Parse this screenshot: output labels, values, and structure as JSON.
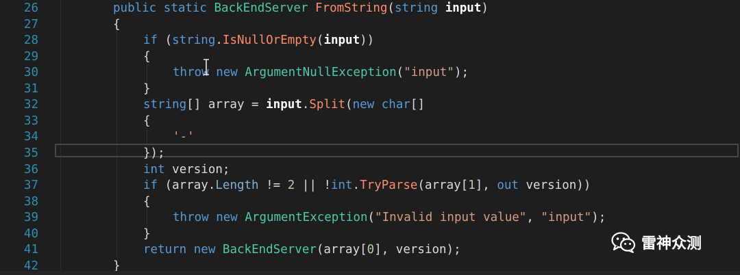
{
  "editor": {
    "lines": [
      {
        "num": "26",
        "indent": 165,
        "tokens": [
          {
            "t": "public static ",
            "c": "kw"
          },
          {
            "t": "BackEndServer ",
            "c": "ty"
          },
          {
            "t": "FromString",
            "c": "method"
          },
          {
            "t": "(",
            "c": "pr"
          },
          {
            "t": "string ",
            "c": "kw"
          },
          {
            "t": "input",
            "c": "bold"
          },
          {
            "t": ")",
            "c": "pr"
          }
        ]
      },
      {
        "num": "27",
        "indent": 165,
        "tokens": [
          {
            "t": "{",
            "c": "pr"
          }
        ]
      },
      {
        "num": "28",
        "indent": 209,
        "tokens": [
          {
            "t": "if ",
            "c": "kw"
          },
          {
            "t": "(",
            "c": "pr"
          },
          {
            "t": "string",
            "c": "kw"
          },
          {
            "t": ".",
            "c": "pr"
          },
          {
            "t": "IsNullOrEmpty",
            "c": "method"
          },
          {
            "t": "(",
            "c": "pr"
          },
          {
            "t": "input",
            "c": "bold"
          },
          {
            "t": "))",
            "c": "pr"
          }
        ]
      },
      {
        "num": "29",
        "indent": 209,
        "tokens": [
          {
            "t": "{",
            "c": "pr"
          }
        ]
      },
      {
        "num": "30",
        "indent": 252,
        "tokens": [
          {
            "t": "throw ",
            "c": "kw"
          },
          {
            "t": "new ",
            "c": "kw"
          },
          {
            "t": "ArgumentNullException",
            "c": "ty"
          },
          {
            "t": "(",
            "c": "pr"
          },
          {
            "t": "\"input\"",
            "c": "str"
          },
          {
            "t": ");",
            "c": "pr"
          }
        ]
      },
      {
        "num": "31",
        "indent": 209,
        "tokens": [
          {
            "t": "}",
            "c": "pr"
          }
        ]
      },
      {
        "num": "32",
        "indent": 209,
        "tokens": [
          {
            "t": "string",
            "c": "kw"
          },
          {
            "t": "[] array = ",
            "c": "id"
          },
          {
            "t": "input",
            "c": "bold"
          },
          {
            "t": ".",
            "c": "pr"
          },
          {
            "t": "Split",
            "c": "method"
          },
          {
            "t": "(",
            "c": "pr"
          },
          {
            "t": "new ",
            "c": "kw"
          },
          {
            "t": "char",
            "c": "kw"
          },
          {
            "t": "[]",
            "c": "pr"
          }
        ]
      },
      {
        "num": "33",
        "indent": 209,
        "tokens": [
          {
            "t": "{",
            "c": "pr"
          }
        ]
      },
      {
        "num": "34",
        "indent": 252,
        "tokens": [
          {
            "t": "'-'",
            "c": "str"
          }
        ]
      },
      {
        "num": "35",
        "indent": 209,
        "tokens": [
          {
            "t": "});",
            "c": "pr"
          }
        ]
      },
      {
        "num": "36",
        "indent": 209,
        "tokens": [
          {
            "t": "int ",
            "c": "kw"
          },
          {
            "t": "version;",
            "c": "id"
          }
        ]
      },
      {
        "num": "37",
        "indent": 209,
        "tokens": [
          {
            "t": "if ",
            "c": "kw"
          },
          {
            "t": "(array.",
            "c": "id"
          },
          {
            "t": "Length",
            "c": "prop"
          },
          {
            "t": " != ",
            "c": "pr"
          },
          {
            "t": "2",
            "c": "nm"
          },
          {
            "t": " || !",
            "c": "pr"
          },
          {
            "t": "int",
            "c": "kw"
          },
          {
            "t": ".",
            "c": "pr"
          },
          {
            "t": "TryParse",
            "c": "method"
          },
          {
            "t": "(array[",
            "c": "id"
          },
          {
            "t": "1",
            "c": "nm"
          },
          {
            "t": "], ",
            "c": "pr"
          },
          {
            "t": "out ",
            "c": "kw"
          },
          {
            "t": "version))",
            "c": "id"
          }
        ]
      },
      {
        "num": "38",
        "indent": 209,
        "tokens": [
          {
            "t": "{",
            "c": "pr"
          }
        ]
      },
      {
        "num": "39",
        "indent": 252,
        "tokens": [
          {
            "t": "throw ",
            "c": "kw"
          },
          {
            "t": "new ",
            "c": "kw"
          },
          {
            "t": "ArgumentException",
            "c": "ty"
          },
          {
            "t": "(",
            "c": "pr"
          },
          {
            "t": "\"Invalid input value\"",
            "c": "str"
          },
          {
            "t": ", ",
            "c": "pr"
          },
          {
            "t": "\"input\"",
            "c": "str"
          },
          {
            "t": ");",
            "c": "pr"
          }
        ]
      },
      {
        "num": "40",
        "indent": 209,
        "tokens": [
          {
            "t": "}",
            "c": "pr"
          }
        ]
      },
      {
        "num": "41",
        "indent": 209,
        "tokens": [
          {
            "t": "return ",
            "c": "kw"
          },
          {
            "t": "new ",
            "c": "kw"
          },
          {
            "t": "BackEndServer",
            "c": "ty"
          },
          {
            "t": "(array[",
            "c": "id"
          },
          {
            "t": "0",
            "c": "nm"
          },
          {
            "t": "], version);",
            "c": "id"
          }
        ]
      },
      {
        "num": "42",
        "indent": 165,
        "tokens": [
          {
            "t": "}",
            "c": "pr"
          }
        ]
      }
    ]
  },
  "watermark": {
    "text": "雷神众测",
    "icon": "wechat-icon"
  },
  "colors": {
    "background": "#1e1e1e",
    "line_number": "#2b91af",
    "keyword": "#569cd6",
    "type": "#4ec9b0",
    "method": "#ff8c6b",
    "string": "#d69d85",
    "number": "#b5cea8"
  }
}
